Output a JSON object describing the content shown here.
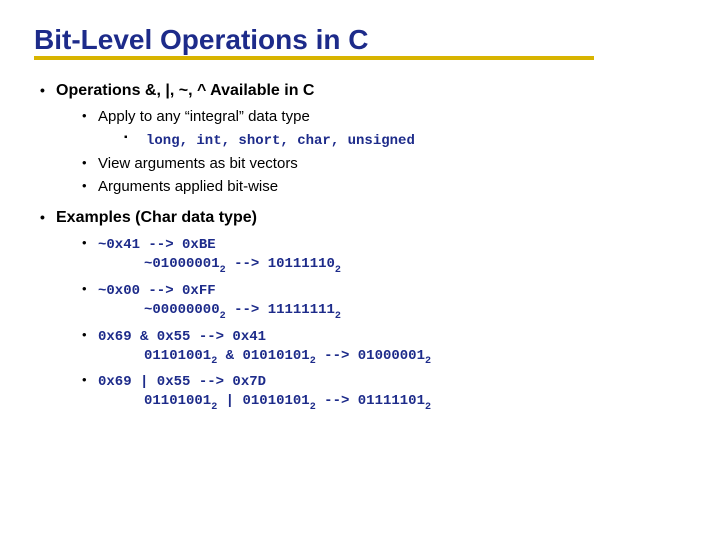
{
  "title": "Bit-Level Operations in C",
  "bullet1": {
    "heading": "Operations &,  |,  ~,  ^ Available in C",
    "sub1": "Apply to any “integral” data type",
    "sub1_detail": "long, int, short, char, unsigned",
    "sub2": "View arguments as bit vectors",
    "sub3": "Arguments applied bit-wise"
  },
  "bullet2": {
    "heading": "Examples (Char data type)",
    "ex1_a": "~0x41  -->   0xBE",
    "ex1_b_pre": "~01000001",
    "ex1_b_mid": "       -->    10111110",
    "ex2_a": "~0x00  -->   0xFF",
    "ex2_b_pre": "~00000000",
    "ex2_b_mid": "       -->    11111111",
    "ex3_a": "0x69 & 0x55   -->   0x41",
    "ex3_b_pre": "01101001",
    "ex3_b_mid1": " & 01010101",
    "ex3_b_mid2": " --> 01000001",
    "ex4_a": "0x69 | 0x55   -->   0x7D",
    "ex4_b_pre": "01101001",
    "ex4_b_mid1": " | 01010101",
    "ex4_b_mid2": " --> 01111101"
  },
  "sub2_glyph": "2"
}
